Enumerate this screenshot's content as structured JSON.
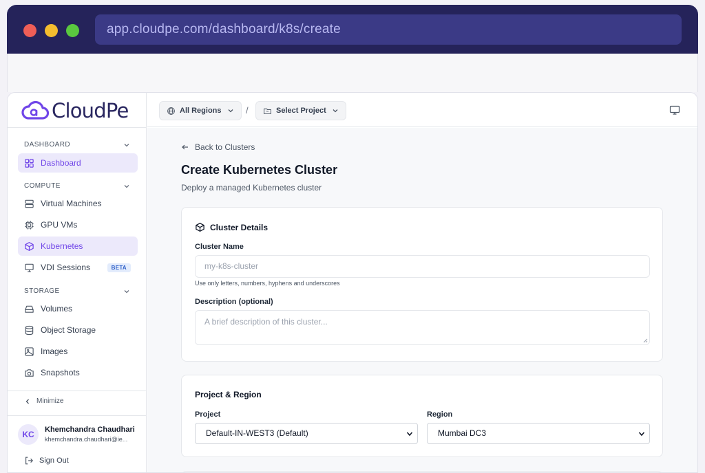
{
  "browser": {
    "url": "app.cloudpe.com/dashboard/k8s/create"
  },
  "brand": {
    "name": "CloudPe",
    "accent": "#7046e8",
    "logo_color": "#2a2760"
  },
  "topbar": {
    "region_label": "All Regions",
    "separator": "/",
    "project_label": "Select Project"
  },
  "sidebar": {
    "sections": [
      {
        "label": "DASHBOARD",
        "items": [
          {
            "label": "Dashboard",
            "icon": "grid-icon",
            "active": false
          }
        ]
      },
      {
        "label": "COMPUTE",
        "items": [
          {
            "label": "Virtual Machines",
            "icon": "server-icon"
          },
          {
            "label": "GPU VMs",
            "icon": "cpu-icon"
          },
          {
            "label": "Kubernetes",
            "icon": "cube-icon",
            "active": true
          },
          {
            "label": "VDI Sessions",
            "icon": "monitor-icon",
            "badge": "BETA"
          }
        ]
      },
      {
        "label": "STORAGE",
        "items": [
          {
            "label": "Volumes",
            "icon": "drive-icon"
          },
          {
            "label": "Object Storage",
            "icon": "database-icon"
          },
          {
            "label": "Images",
            "icon": "image-icon"
          },
          {
            "label": "Snapshots",
            "icon": "camera-icon"
          }
        ]
      }
    ],
    "minimize_label": "Minimize",
    "user": {
      "initials": "KC",
      "name": "Khemchandra Chaudhari",
      "email": "khemchandra.chaudhari@ie..."
    },
    "signout_label": "Sign Out"
  },
  "main": {
    "back_label": "Back to Clusters",
    "title": "Create Kubernetes Cluster",
    "subtitle": "Deploy a managed Kubernetes cluster",
    "cluster_details": {
      "title": "Cluster Details",
      "name_label": "Cluster Name",
      "name_placeholder": "my-k8s-cluster",
      "name_hint": "Use only letters, numbers, hyphens and underscores",
      "description_label": "Description (optional)",
      "description_placeholder": "A brief description of this cluster..."
    },
    "project_region": {
      "title": "Project & Region",
      "project_label": "Project",
      "project_value": "Default-IN-WEST3 (Default)",
      "region_label": "Region",
      "region_value": "Mumbai DC3"
    }
  }
}
